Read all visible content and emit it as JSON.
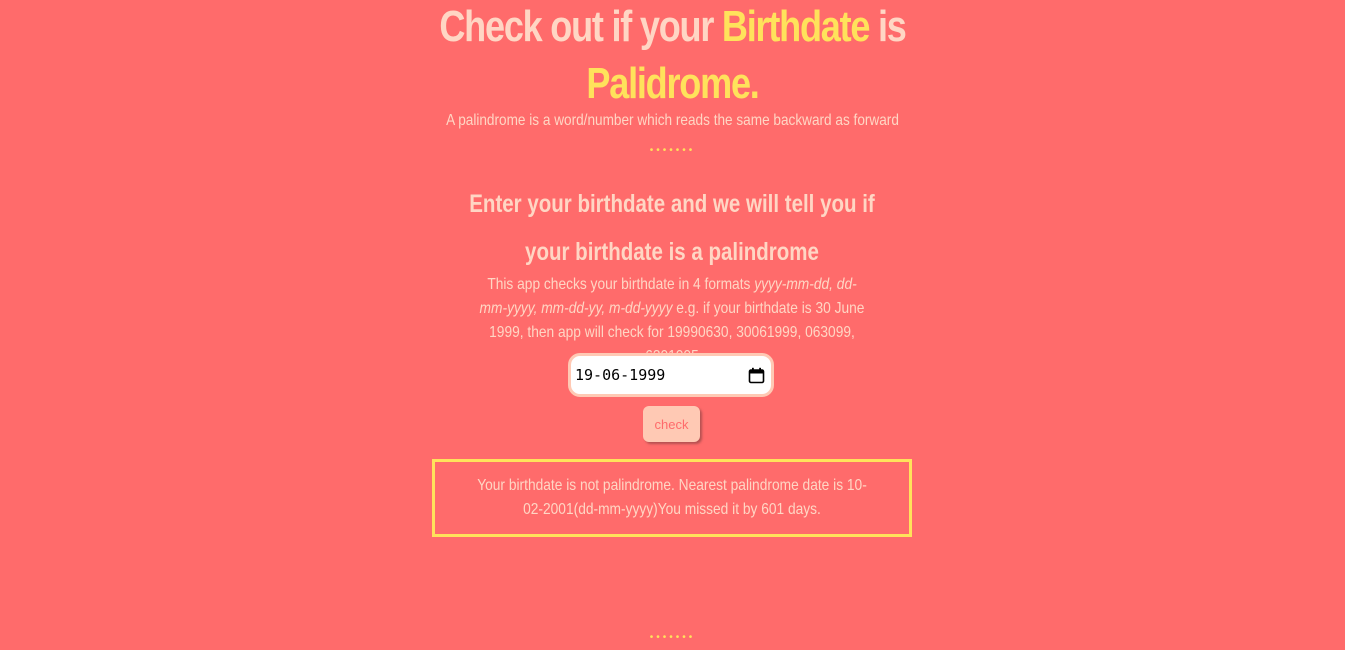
{
  "header": {
    "title_part1": "Check out if your ",
    "title_highlight1": "Birthdate",
    "title_part2": " is",
    "title_highlight2": "Palidrome.",
    "subtitle": "A palindrome is a word/number which reads the same backward as forward",
    "dots": "•••••••"
  },
  "main": {
    "heading": "Enter your birthdate and we will tell you if your birthdate is a palindrome",
    "description": {
      "intro": "This app checks your birthdate in 4 formats ",
      "formats": "yyyy-mm-dd, dd-mm-yyyy, mm-dd-yy, m-dd-yyyy",
      "example": " e.g. if your birthdate is 30 June 1999, then app will check for 19990630, 30061999, 063099, 6301995"
    },
    "date_input": {
      "value": "19-06-1999",
      "icon": "calendar-icon"
    },
    "check_button": "check",
    "result": "Your birthdate is not palindrome. Nearest palindrome date is 10-02-2001(dd-mm-yyyy)You missed it by 601 days."
  },
  "footer": {
    "dots": "•••••••"
  },
  "colors": {
    "background": "#ff6b6b",
    "text": "#ffd6c4",
    "accent": "#ffe25b",
    "button_bg": "#ffc9b4"
  }
}
